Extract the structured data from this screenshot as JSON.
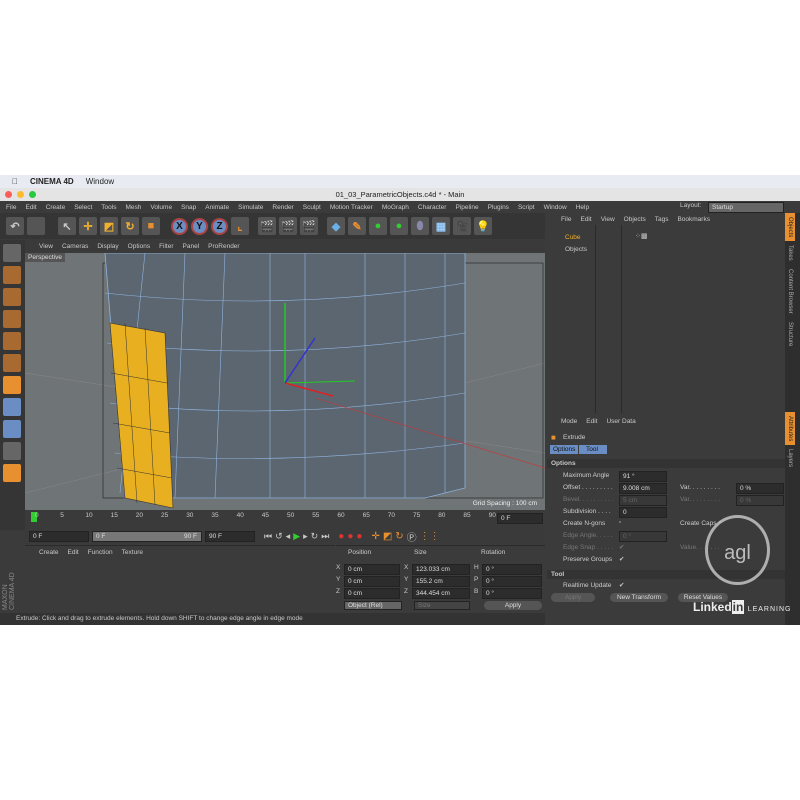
{
  "mac": {
    "app": "CINEMA 4D",
    "menu": "Window"
  },
  "window_title": "01_03_ParametricObjects.c4d * - Main",
  "main_menu": [
    "File",
    "Edit",
    "Create",
    "Select",
    "Tools",
    "Mesh",
    "Volume",
    "Snap",
    "Animate",
    "Simulate",
    "Render",
    "Sculpt",
    "Motion Tracker",
    "MoGraph",
    "Character",
    "Pipeline",
    "Plugins",
    "Script",
    "Window",
    "Help"
  ],
  "layout": {
    "label": "Layout:",
    "value": "Startup"
  },
  "toolbar": {
    "axes": [
      "X",
      "Y",
      "Z"
    ]
  },
  "viewport": {
    "menu": [
      "View",
      "Cameras",
      "Display",
      "Options",
      "Filter",
      "Panel",
      "ProRender"
    ],
    "name": "Perspective",
    "grid_spacing": "Grid Spacing : 100 cm",
    "accent": "#e8b020"
  },
  "timeline": {
    "ticks": [
      "0",
      "5",
      "10",
      "15",
      "20",
      "25",
      "30",
      "35",
      "40",
      "45",
      "50",
      "55",
      "60",
      "65",
      "70",
      "75",
      "80",
      "85",
      "90"
    ],
    "current": "0 F",
    "start": "0 F",
    "range_start": "0 F",
    "range_end": "90 F",
    "end": "90 F"
  },
  "material_menu": [
    "Create",
    "Edit",
    "Function",
    "Texture"
  ],
  "coords": {
    "headers": [
      "Position",
      "Size",
      "Rotation"
    ],
    "rows": [
      {
        "a": "X",
        "pos": "0 cm",
        "s": "X",
        "size": "123.033 cm",
        "r": "H",
        "rot": "0 °"
      },
      {
        "a": "Y",
        "pos": "0 cm",
        "s": "Y",
        "size": "155.2 cm",
        "r": "P",
        "rot": "0 °"
      },
      {
        "a": "Z",
        "pos": "0 cm",
        "s": "Z",
        "size": "344.454 cm",
        "r": "B",
        "rot": "0 °"
      }
    ],
    "mode": "Object (Rel)",
    "size_mode": "Size",
    "apply": "Apply"
  },
  "status": "Extrude: Click and drag to extrude elements. Hold down SHIFT to change edge angle in edge mode",
  "object_manager": {
    "menu": [
      "File",
      "Edit",
      "View",
      "Objects",
      "Tags",
      "Bookmarks"
    ],
    "objects": [
      {
        "name": "Cube",
        "selected": true
      },
      {
        "name": "Objects",
        "selected": false
      }
    ]
  },
  "attributes": {
    "menu": [
      "Mode",
      "Edit",
      "User Data"
    ],
    "tool": "Extrude",
    "tabs": [
      "Options",
      "Tool"
    ],
    "section_options": "Options",
    "max_angle": {
      "label": "Maximum Angle",
      "value": "91 °"
    },
    "offset": {
      "label": "Offset . . . . . . . . .",
      "value": "9.008 cm"
    },
    "var1": {
      "label": "Var. . . . . . . . .",
      "value": "0 %"
    },
    "bevel": {
      "label": "Bevel. . . . . . . . . .",
      "value": "5 cm"
    },
    "var2": {
      "label": "Var. . . . . . . . .",
      "value": "0 %"
    },
    "subdivision": {
      "label": "Subdivision . . . .",
      "value": "0"
    },
    "create_ngons": "Create N-gons",
    "create_caps": "Create Caps",
    "edge_angle": {
      "label": "Edge Angle. . . . .",
      "value": "0 °"
    },
    "edge_snap": "Edge Snap . . . . .",
    "value_label": "Value. . . . . . .",
    "preserve_groups": "Preserve Groups",
    "section_tool": "Tool",
    "realtime_update": "Realtime Update",
    "buttons": [
      "Apply",
      "New Transform",
      "Reset Values"
    ]
  },
  "right_tabs": [
    "Objects",
    "Takes",
    "Content Browser",
    "Structure",
    "Attributes",
    "Layers"
  ],
  "watermark": {
    "brand": "LinkedIn",
    "learning": "LEARNING",
    "logo": "agl"
  },
  "maxon_logo": "MAXON CINEMA 4D"
}
